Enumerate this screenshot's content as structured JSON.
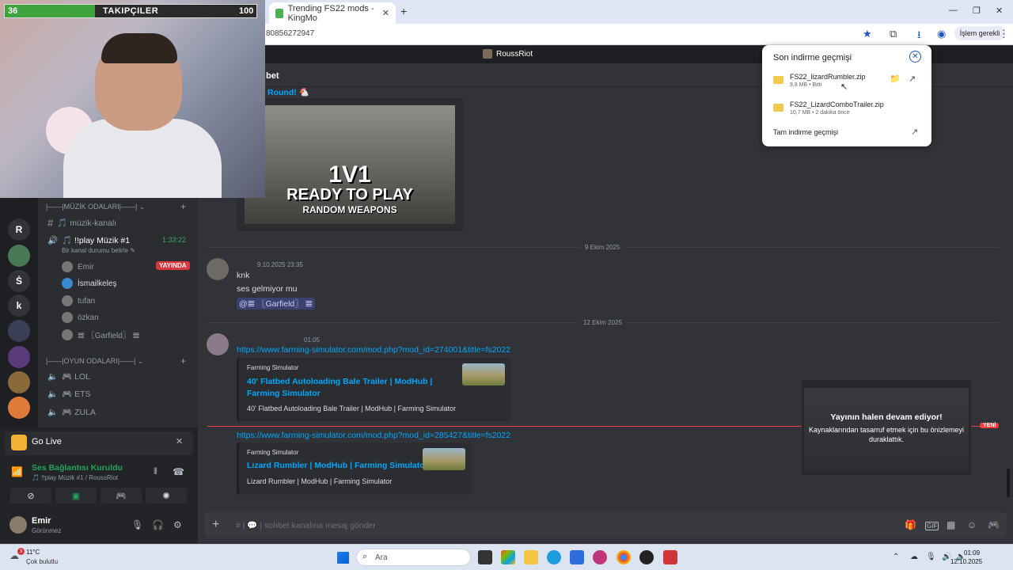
{
  "browser": {
    "tab_title": "Trending FS22 mods - KingMo",
    "tab_close": "✕",
    "new_tab": "+",
    "url_tail": "80856272947",
    "action_label": "İşlem gerekli",
    "window_controls": [
      "—",
      "❐",
      "✕"
    ],
    "toolbar_icons": [
      "★",
      "⧉",
      "⭳",
      "◉",
      "⋮"
    ]
  },
  "stream_overlay": {
    "followers_label": "TAKIPÇILER",
    "followers_current": "36",
    "followers_goal": "100",
    "followers_progress": 0.36
  },
  "downloads": {
    "title": "Son indirme geçmişi",
    "close": "✕",
    "items": [
      {
        "name": "FS22_lizardRumbler.zip",
        "meta": "9,8 MB • Bitti"
      },
      {
        "name": "FS22_LizardComboTrailer.zip",
        "meta": "10,7 MB • 2 dakika önce"
      }
    ],
    "full_history": "Tam indirme geçmişi",
    "folder_icon": "📁",
    "open_icon": "↗"
  },
  "discord": {
    "server_name": "RoussRiot",
    "channel_header": "bet",
    "servers": [
      "R",
      "Ṡ",
      "k"
    ],
    "categories": [
      {
        "label": "|——|MÜZİK ODALARI|——| ⌄"
      },
      {
        "label": "|——|OYUN ODALARI|——| ⌄"
      }
    ],
    "music_channels": [
      {
        "icon": "#",
        "label": "🎵 müzik-kanalı"
      },
      {
        "icon": "🔊",
        "label": "🎵 !!play Müzik #1"
      }
    ],
    "timer": "1:33:22",
    "status_hint": "Bir kanal durumu belirle ✎",
    "voice_users": [
      {
        "name": "Emir",
        "badge": "YAYINDA"
      },
      {
        "name": "İsmailkeleş"
      },
      {
        "name": "tufan"
      },
      {
        "name": "özkan"
      },
      {
        "name": "𝌆 〖Garfield〗 𝌆"
      }
    ],
    "game_channels": [
      "🎮 LOL",
      "🎮 ETS",
      "🎮 ZULA"
    ],
    "go_live": "Go Live",
    "connection_title": "Ses Bağlantısı Kuruldu",
    "connection_sub": "🎵 !!play Müzik #1 / RoussRiot",
    "panel_buttons": [
      "⊘",
      "▣",
      "🎮",
      "✺"
    ],
    "user": {
      "name": "Emir",
      "status": "Görünmez"
    },
    "user_controls": [
      "🎙",
      "🎧",
      "⚙"
    ]
  },
  "chat": {
    "round_text": "Round! 🐔",
    "game_image": {
      "line1": "1V1",
      "line2": "READY TO PLAY",
      "line3": "RANDOM WEAPONS"
    },
    "date1": "9 Ekim 2025",
    "msg1": {
      "time": "9.10.2025 23:35",
      "lines": [
        "knk",
        "ses gelmiyor mu"
      ],
      "mention": "@𝌆 〖Garfield〗 𝌆"
    },
    "date2": "12 Ekim 2025",
    "msg2": {
      "time": "01:05",
      "link1": "https://www.farming-simulator.com/mod.php?mod_id=274001&title=fs2022",
      "embed1": {
        "provider": "Farming Simulator",
        "title": "40' Flatbed Autoloading Bale Trailer | ModHub | Farming Simulator",
        "desc": "40' Flatbed Autoloading Bale Trailer | ModHub | Farming Simulator"
      },
      "link2": "https://www.farming-simulator.com/mod.php?mod_id=285427&title=fs2022",
      "embed2": {
        "provider": "Farming Simulator",
        "title": "Lizard Rumbler | ModHub | Farming Simulator",
        "desc": "Lizard Rumbler | ModHub | Farming Simulator"
      }
    },
    "new_badge": "YENİ",
    "composer_placeholder": "sohbet kanalına mesaj gönder",
    "composer_icons": [
      "🎁",
      "GIF",
      "▦",
      "☺",
      "🎮"
    ]
  },
  "stream_preview": {
    "title": "Yayının halen devam ediyor!",
    "desc": "Kaynaklarından tasarruf etmek için bu önizlemeyi duraklattık."
  },
  "taskbar": {
    "weather_temp": "11°C",
    "weather_cond": "Çok bulutlu",
    "weather_badge": "3",
    "search": "Ara",
    "time": "01:09",
    "date": "12.10.2025",
    "tray": [
      "⌃",
      "☁",
      "🎙",
      "🔊",
      "🔈"
    ]
  },
  "colors": {
    "discord_bg": "#313338",
    "sidebar": "#2b2d31",
    "link": "#00a8fc",
    "live_red": "#da373c",
    "voice_green": "#23a559"
  }
}
